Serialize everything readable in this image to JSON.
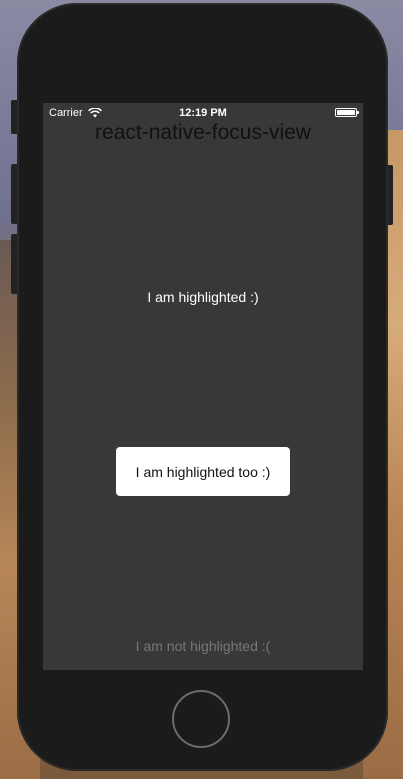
{
  "status_bar": {
    "carrier": "Carrier",
    "time": "12:19 PM",
    "icons": [
      "wifi-icon",
      "battery-icon"
    ]
  },
  "app": {
    "title": "react-native-focus-view",
    "highlighted_text": "I am highlighted :)",
    "highlighted_card_text": "I am highlighted too :)",
    "not_highlighted_text": "I am not highlighted :("
  },
  "colors": {
    "screen_background": "#383838",
    "card_background": "#ffffff",
    "dim_text": "#777777",
    "phone_body": "#1b1b1b"
  }
}
